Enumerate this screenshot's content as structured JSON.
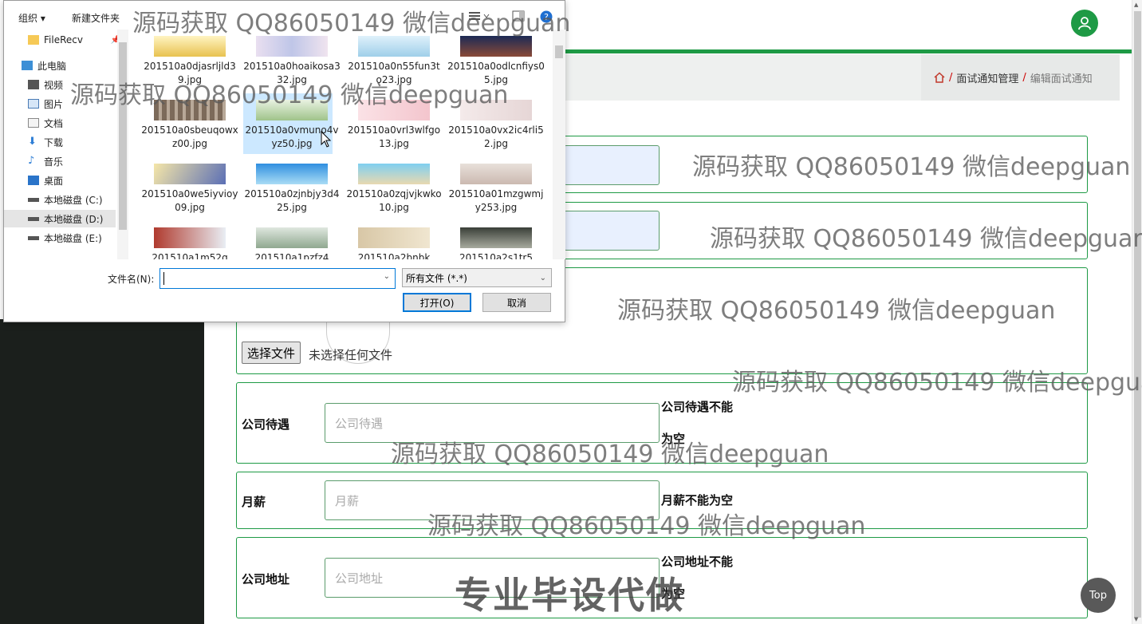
{
  "breadcrumb": {
    "home_icon": "home-icon",
    "items": [
      "面试通知管理",
      "编辑面试通知"
    ]
  },
  "form": {
    "file_button": "选择文件",
    "file_status": "未选择任何文件",
    "rows": [
      {
        "label": "公司待遇",
        "placeholder": "公司待遇",
        "error": "公司待遇不能为空"
      },
      {
        "label": "月薪",
        "placeholder": "月薪",
        "error": "月薪不能为空"
      },
      {
        "label": "公司地址",
        "placeholder": "公司地址",
        "error": "公司地址不能为空"
      }
    ]
  },
  "top_button": "Top",
  "dialog": {
    "toolbar": {
      "organize": "组织",
      "new_folder": "新建文件夹"
    },
    "nav": [
      {
        "label": "FileRecv",
        "icon": "folder-icon"
      },
      {
        "label": "此电脑",
        "icon": "computer-icon"
      },
      {
        "label": "视频",
        "icon": "video-icon"
      },
      {
        "label": "图片",
        "icon": "pictures-icon"
      },
      {
        "label": "文档",
        "icon": "documents-icon"
      },
      {
        "label": "下载",
        "icon": "download-icon"
      },
      {
        "label": "音乐",
        "icon": "music-icon"
      },
      {
        "label": "桌面",
        "icon": "desktop-icon"
      },
      {
        "label": "本地磁盘 (C:)",
        "icon": "drive-icon"
      },
      {
        "label": "本地磁盘 (D:)",
        "icon": "drive-icon"
      },
      {
        "label": "本地磁盘 (E:)",
        "icon": "drive-icon"
      }
    ],
    "files": [
      "201510a0djasrljld39.jpg",
      "201510a0hoaikosa332.jpg",
      "201510a0n55fun3to23.jpg",
      "201510a0odlcnfiys05.jpg",
      "201510a0sbeuqowxz00.jpg",
      "201510a0vmuno4vyz50.jpg",
      "201510a0vrl3wlfgo13.jpg",
      "201510a0vx2ic4rli52.jpg",
      "201510a0we5iyvioy09.jpg",
      "201510a0zjnbjy3d425.jpg",
      "201510a0zqjvjkwko10.jpg",
      "201510a01mzgwmjy253.jpg",
      "201510a1m52g",
      "201510a1pzfz4",
      "201510a2bnbk",
      "201510a2s1tr5"
    ],
    "filename_label": "文件名(N):",
    "filename_value": "",
    "filetype": "所有文件 (*.*)",
    "open": "打开(O)",
    "cancel": "取消"
  },
  "watermarks": {
    "text": "源码获取 QQ86050149 微信deepguan",
    "big": "专业毕设代做"
  },
  "colors": {
    "accent": "#1e9a45",
    "selection": "#cce8ff",
    "dialog_focus": "#0078d7"
  }
}
